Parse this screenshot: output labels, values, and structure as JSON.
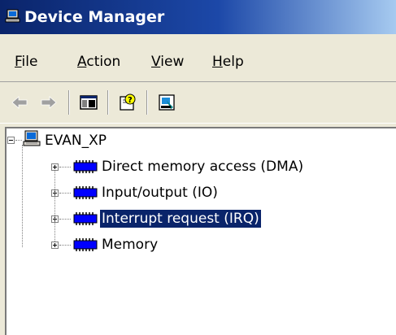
{
  "window": {
    "title": "Device Manager"
  },
  "menu": {
    "items": [
      {
        "label": "File",
        "mnemonic": "F",
        "rest": "ile"
      },
      {
        "label": "Action",
        "mnemonic": "A",
        "rest": "ction"
      },
      {
        "label": "View",
        "mnemonic": "V",
        "rest": "iew"
      },
      {
        "label": "Help",
        "mnemonic": "H",
        "rest": "elp"
      }
    ]
  },
  "toolbar": {
    "buttons": [
      {
        "icon": "back-arrow-icon",
        "enabled": false
      },
      {
        "icon": "forward-arrow-icon",
        "enabled": false
      },
      {
        "icon": "show-hide-console-tree-icon",
        "enabled": true
      },
      {
        "icon": "help-icon",
        "enabled": true
      },
      {
        "icon": "properties-icon",
        "enabled": true
      }
    ]
  },
  "tree": {
    "root": {
      "label": "EVAN_XP",
      "expanded": true
    },
    "children": [
      {
        "label": "Direct memory access (DMA)",
        "selected": false
      },
      {
        "label": "Input/output (IO)",
        "selected": false
      },
      {
        "label": "Interrupt request (IRQ)",
        "selected": true
      },
      {
        "label": "Memory",
        "selected": false
      }
    ]
  },
  "colors": {
    "title_gradient_start": "#0a246a",
    "title_gradient_end": "#a6caf0",
    "chrome": "#ece9d8",
    "selection": "#0a246a",
    "chip_blue": "#0000ff"
  }
}
